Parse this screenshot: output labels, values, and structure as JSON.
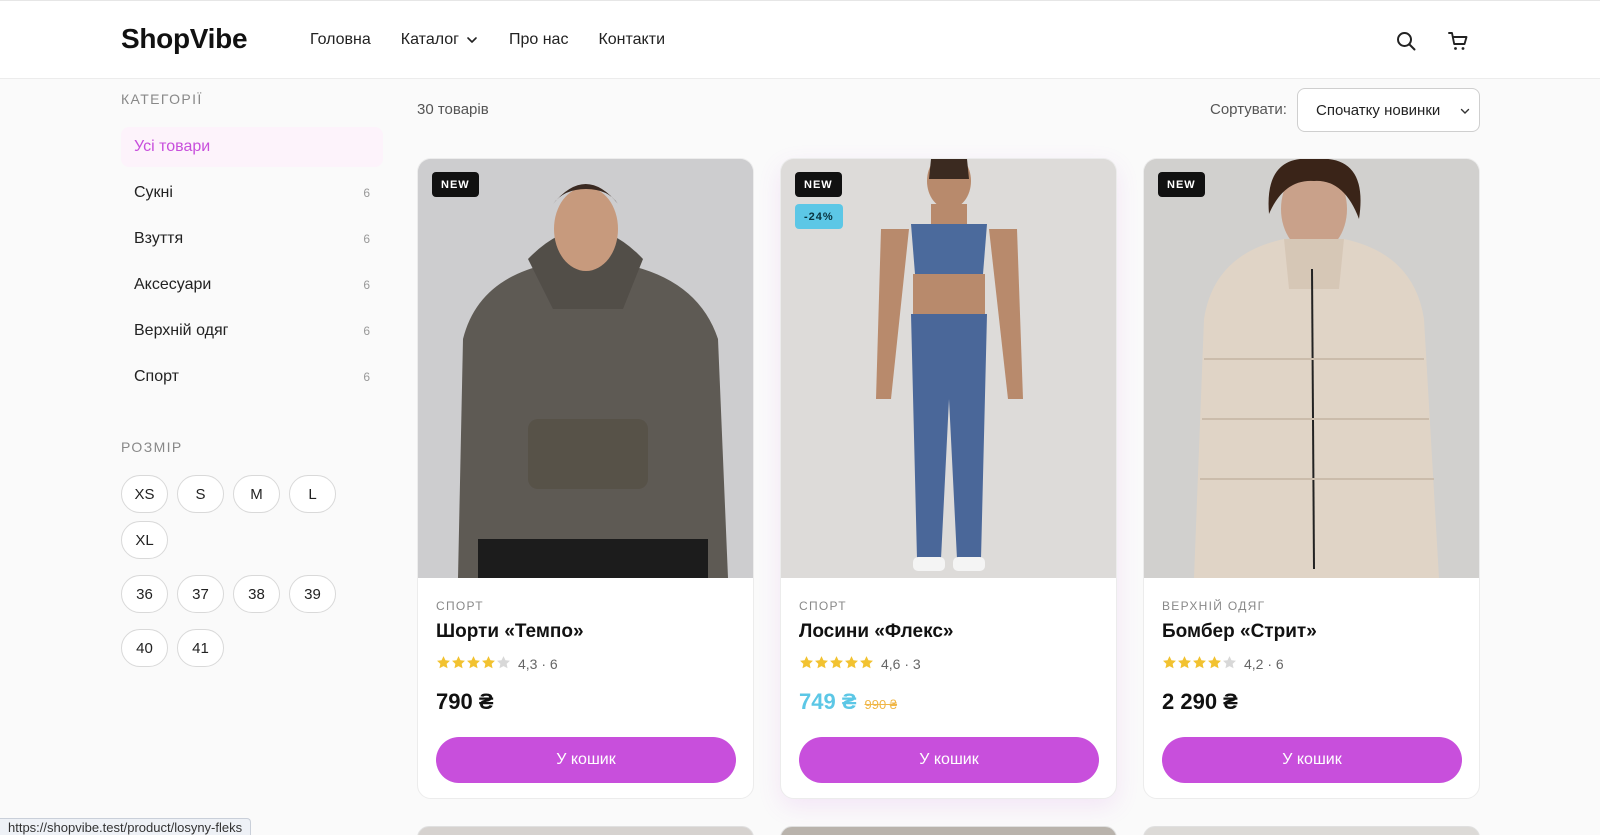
{
  "header": {
    "logo": "ShopVibe",
    "nav": [
      "Головна",
      "Каталог",
      "Про нас",
      "Контакти"
    ],
    "icons": [
      "search-icon",
      "cart-icon"
    ]
  },
  "sidebar": {
    "categories_heading": "КАТЕГОРІЇ",
    "categories": [
      {
        "label": "Усі товари",
        "count": "",
        "active": true
      },
      {
        "label": "Сукні",
        "count": "6"
      },
      {
        "label": "Взуття",
        "count": "6"
      },
      {
        "label": "Аксесуари",
        "count": "6"
      },
      {
        "label": "Верхній одяг",
        "count": "6"
      },
      {
        "label": "Спорт",
        "count": "6"
      }
    ],
    "size_heading": "РОЗМІР",
    "sizes": [
      "XS",
      "S",
      "M",
      "L",
      "XL",
      "36",
      "37",
      "38",
      "39",
      "40",
      "41"
    ]
  },
  "toolbar": {
    "results": "30 товарів",
    "sort_label": "Сортувати:",
    "sort_value": "Спочатку новинки"
  },
  "products": [
    {
      "category": "СПОРТ",
      "title": "Шорти «Темпо»",
      "rating": 4.3,
      "rating_text": "4,3 · 6",
      "price": "790 ₴",
      "old_price": "",
      "badges": [
        "NEW"
      ],
      "button": "У кошик"
    },
    {
      "category": "СПОРТ",
      "title": "Лосини «Флекс»",
      "rating": 4.6,
      "rating_text": "4,6 · 3",
      "price": "749 ₴",
      "old_price": "990 ₴",
      "badges": [
        "NEW",
        "-24%"
      ],
      "button": "У кошик"
    },
    {
      "category": "ВЕРХНІЙ ОДЯГ",
      "title": "Бомбер «Стрит»",
      "rating": 4.2,
      "rating_text": "4,2 · 6",
      "price": "2 290 ₴",
      "old_price": "",
      "badges": [
        "NEW"
      ],
      "button": "У кошик"
    }
  ],
  "colors": {
    "accent": "#c84fdc",
    "sale": "#5cc7e6",
    "old_price": "#f0b646",
    "star": "#f2c230"
  },
  "status_bar": {
    "url": "https://shopvibe.test/product/losyny-fleks"
  }
}
